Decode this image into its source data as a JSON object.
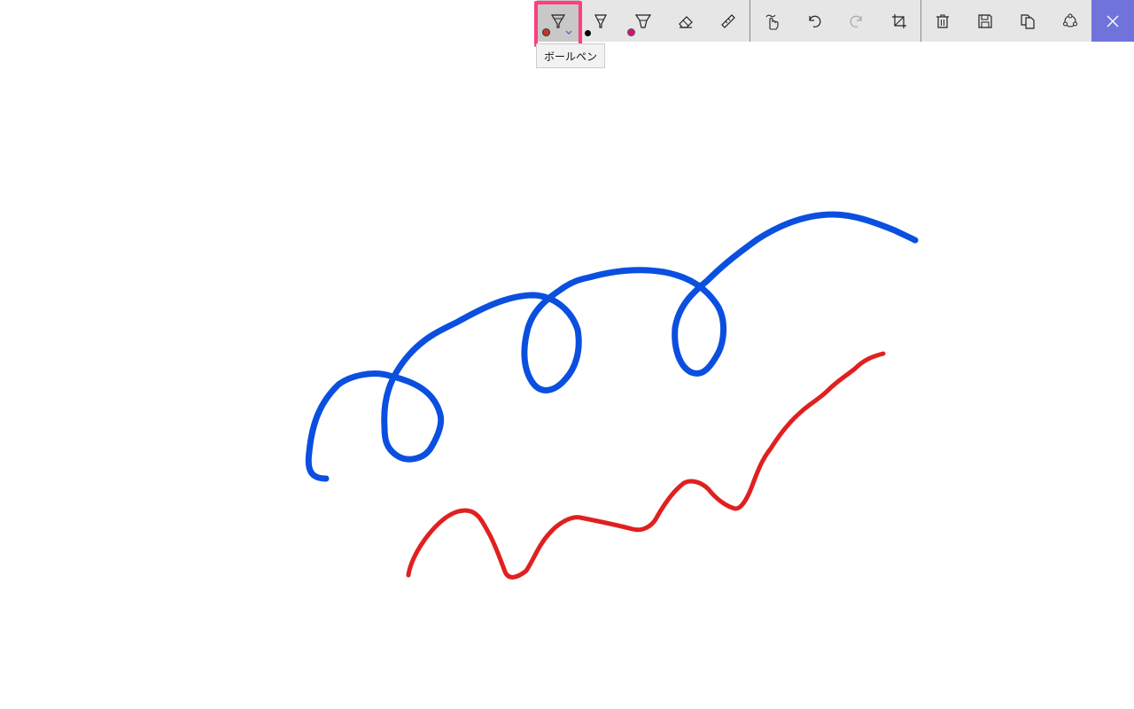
{
  "toolbar": {
    "tools": [
      {
        "id": "ballpoint",
        "icon": "ballpoint-pen-icon",
        "color": "#c0392b",
        "selected": true
      },
      {
        "id": "pencil",
        "icon": "pencil-icon",
        "color": "#000000"
      },
      {
        "id": "highlighter",
        "icon": "highlighter-icon",
        "color": "#d8127a"
      },
      {
        "id": "eraser",
        "icon": "eraser-icon"
      },
      {
        "id": "ruler",
        "icon": "ruler-icon"
      },
      {
        "id": "touch-writing",
        "icon": "touch-writing-icon"
      },
      {
        "id": "undo",
        "icon": "undo-icon"
      },
      {
        "id": "redo",
        "icon": "redo-icon"
      },
      {
        "id": "crop",
        "icon": "crop-icon"
      },
      {
        "id": "delete",
        "icon": "trash-icon"
      },
      {
        "id": "save",
        "icon": "save-icon"
      },
      {
        "id": "copy",
        "icon": "copy-icon"
      },
      {
        "id": "share",
        "icon": "share-icon"
      },
      {
        "id": "close",
        "icon": "close-icon"
      }
    ],
    "accent": "#7173dd",
    "highlight_color": "#ff3d7f"
  },
  "tooltip": {
    "text": "ボールペン"
  },
  "strokes": {
    "blue_color": "#0a4fe0",
    "red_color": "#e02020"
  }
}
